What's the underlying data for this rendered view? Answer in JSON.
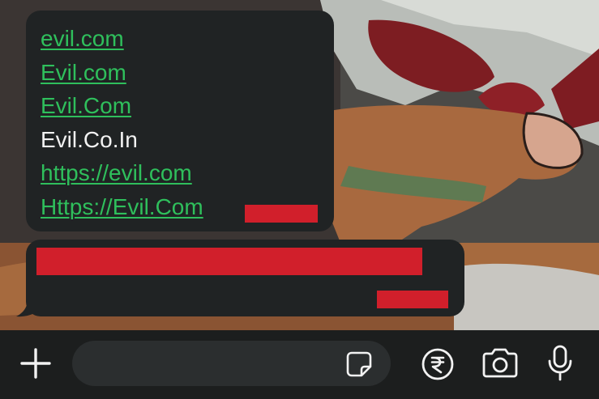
{
  "chat": {
    "message_1": {
      "lines": [
        {
          "text": "evil.com",
          "type": "link"
        },
        {
          "text": "Evil.com",
          "type": "link"
        },
        {
          "text": "Evil.Com",
          "type": "link"
        },
        {
          "text": "Evil.Co.In",
          "type": "plain"
        },
        {
          "text": "https://evil.com",
          "type": "link"
        },
        {
          "text": "Https://Evil.Com",
          "type": "link"
        }
      ]
    }
  },
  "composer": {
    "input_value": "",
    "icons": [
      "plus-icon",
      "sticker-icon",
      "rupee-payment-icon",
      "camera-icon",
      "microphone-icon"
    ]
  },
  "colors": {
    "bubble": "#202324",
    "link": "#2fbf5c",
    "redaction": "#d11f2b",
    "bar": "#1c1e1e"
  }
}
